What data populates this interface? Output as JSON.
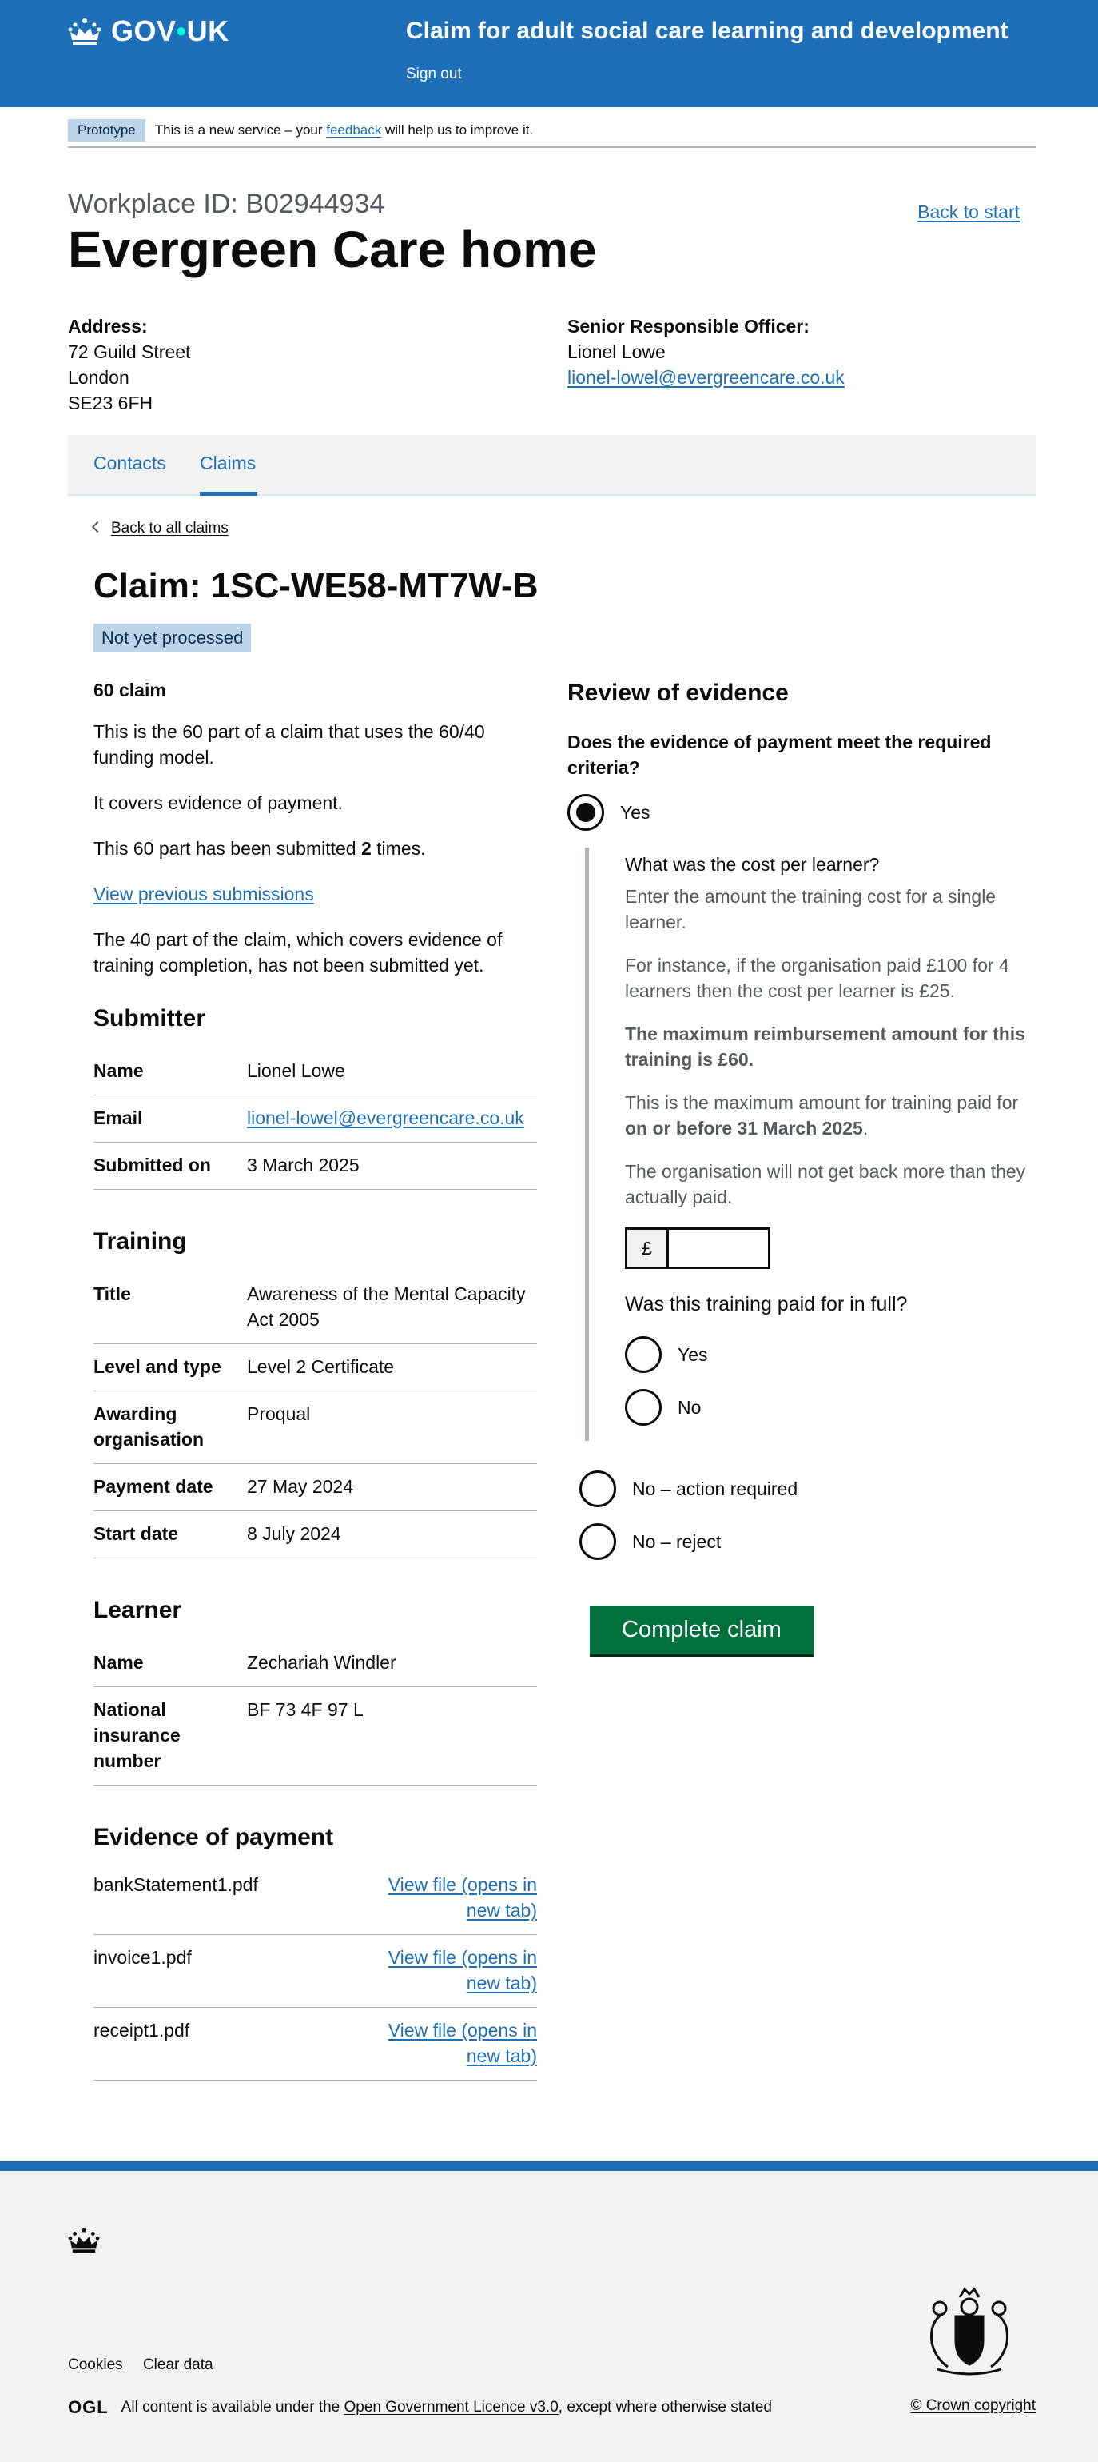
{
  "header": {
    "logo_text": "GOV",
    "logo_text_suffix": "UK",
    "service_name": "Claim for adult social care learning and development",
    "sign_out": "Sign out"
  },
  "phase_banner": {
    "tag": "Prototype",
    "text_before": "This is a new service – your",
    "link": "feedback",
    "text_after": "will help us to improve it."
  },
  "workplace": {
    "caption": "Workplace ID: B02944934",
    "name": "Evergreen Care home",
    "back_to_start": "Back to start",
    "address_label": "Address:",
    "address_lines": [
      "72 Guild Street",
      "London",
      "SE23 6FH"
    ],
    "sro_label": "Senior Responsible Officer:",
    "sro_name": "Lionel Lowe",
    "sro_email": "lionel-lowel@evergreencare.co.uk"
  },
  "subnav": {
    "items": [
      {
        "label": "Contacts",
        "active": false
      },
      {
        "label": "Claims",
        "active": true
      }
    ]
  },
  "claim": {
    "back_link": "Back to all claims",
    "title": "Claim: 1SC-WE58-MT7W-B",
    "status": "Not yet processed",
    "part_heading": "60 claim",
    "para1": "This is the 60 part of a claim that uses the 60/40 funding model.",
    "para2": "It covers evidence of payment.",
    "para3_before": "This 60 part has been submitted",
    "para3_count": "2",
    "para3_after": "times.",
    "prev_link": "View previous submissions",
    "para4": "The 40 part of the claim, which covers evidence of training completion, has not been submitted yet."
  },
  "submitter": {
    "heading": "Submitter",
    "rows": [
      {
        "key": "Name",
        "value": "Lionel Lowe"
      },
      {
        "key": "Email",
        "value": "lionel-lowel@evergreencare.co.uk"
      },
      {
        "key": "Submitted on",
        "value": "3 March 2025"
      }
    ]
  },
  "training": {
    "heading": "Training",
    "rows": [
      {
        "key": "Title",
        "value": "Awareness of the Mental Capacity Act 2005"
      },
      {
        "key": "Level and type",
        "value": "Level 2 Certificate"
      },
      {
        "key": "Awarding organisation",
        "value": "Proqual"
      },
      {
        "key": "Payment date",
        "value": "27 May 2024"
      },
      {
        "key": "Start date",
        "value": "8 July 2024"
      }
    ]
  },
  "learner": {
    "heading": "Learner",
    "rows": [
      {
        "key": "Name",
        "value": "Zechariah Windler"
      },
      {
        "key": "National insurance number",
        "value": "BF 73 4F 97 L"
      }
    ]
  },
  "evidence": {
    "heading": "Evidence of payment",
    "action_label": "View file (opens in new tab)",
    "files": [
      "bankStatement1.pdf",
      "invoice1.pdf",
      "receipt1.pdf"
    ]
  },
  "review": {
    "heading": "Review of evidence",
    "question": "Does the evidence of payment meet the required criteria?",
    "yes_label": "Yes",
    "cost_label": "What was the cost per learner?",
    "hint1": "Enter the amount the training cost for a single learner.",
    "hint2": "For instance, if the organisation paid £100 for 4 learners then the cost per learner is £25.",
    "hint3": "The maximum reimbursement amount for this training is £60.",
    "hint4_before": "This is the maximum amount for training paid for",
    "hint4_bold": "on or before 31 March 2025",
    "hint4_after": ".",
    "hint5": "The organisation will not get back more than they actually paid.",
    "currency_prefix": "£",
    "cost_value": "",
    "full_question": "Was this training paid for in full?",
    "full_yes": "Yes",
    "full_no": "No",
    "no_action": "No – action required",
    "no_reject": "No – reject",
    "submit": "Complete claim"
  },
  "footer": {
    "cookies": "Cookies",
    "clear_data": "Clear data",
    "ogl": "OGL",
    "licence_before": "All content is available under the",
    "licence_link": "Open Government Licence v3.0",
    "licence_after": ", except where otherwise stated",
    "copyright": "© Crown copyright"
  }
}
